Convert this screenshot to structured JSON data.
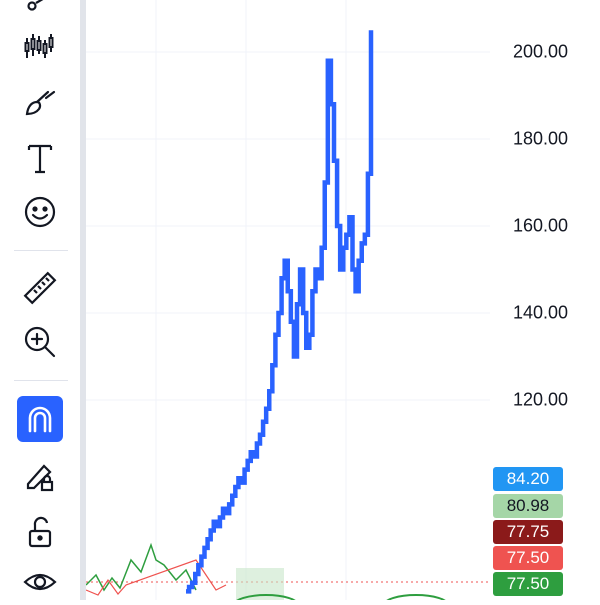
{
  "toolbar": {
    "tools": [
      {
        "name": "fib-tool-icon"
      },
      {
        "name": "candles-pattern-icon"
      },
      {
        "name": "brush-icon"
      },
      {
        "name": "text-tool-icon"
      },
      {
        "name": "emoji-icon"
      },
      {
        "name": "ruler-icon"
      },
      {
        "name": "zoom-in-icon"
      },
      {
        "name": "magnet-icon",
        "active": true
      },
      {
        "name": "lock-drawing-icon"
      },
      {
        "name": "unlock-icon"
      },
      {
        "name": "eye-icon"
      }
    ],
    "accent": "#2962ff"
  },
  "price_axis": {
    "ticks": [
      "200.00",
      "180.00",
      "160.00",
      "140.00",
      "120.00"
    ]
  },
  "price_badges": [
    {
      "label": "84.20",
      "bg": "#2196f3",
      "fg": "#ffffff"
    },
    {
      "label": "80.98",
      "bg": "#a5d6a7",
      "fg": "#131722"
    },
    {
      "label": "77.75",
      "bg": "#8b1a1a",
      "fg": "#ffffff"
    },
    {
      "label": "77.50",
      "bg": "#ef5350",
      "fg": "#ffffff"
    },
    {
      "label": "77.50",
      "bg": "#2e9e3f",
      "fg": "#ffffff"
    }
  ],
  "chart_data": {
    "type": "line",
    "ylim": [
      70,
      212
    ],
    "yticks": [
      120,
      140,
      160,
      180,
      200
    ],
    "series": [
      {
        "color": "#2962ff",
        "values": [
          76,
          77,
          78,
          80,
          82,
          84,
          86,
          88,
          90,
          92,
          91,
          93,
          95,
          94,
          96,
          98,
          100,
          102,
          101,
          104,
          106,
          108,
          107,
          110,
          112,
          115,
          118,
          122,
          128,
          135,
          140,
          148,
          152,
          145,
          138,
          130,
          142,
          150,
          140,
          132,
          135,
          145,
          150,
          148,
          155,
          170,
          198,
          188,
          175,
          160,
          150,
          155,
          158,
          162,
          150,
          145,
          152,
          156,
          158,
          172,
          205
        ]
      }
    ],
    "colors": {
      "up": "#2962ff",
      "indicator_green": "#2e9e3f",
      "indicator_red": "#ef5350"
    }
  }
}
